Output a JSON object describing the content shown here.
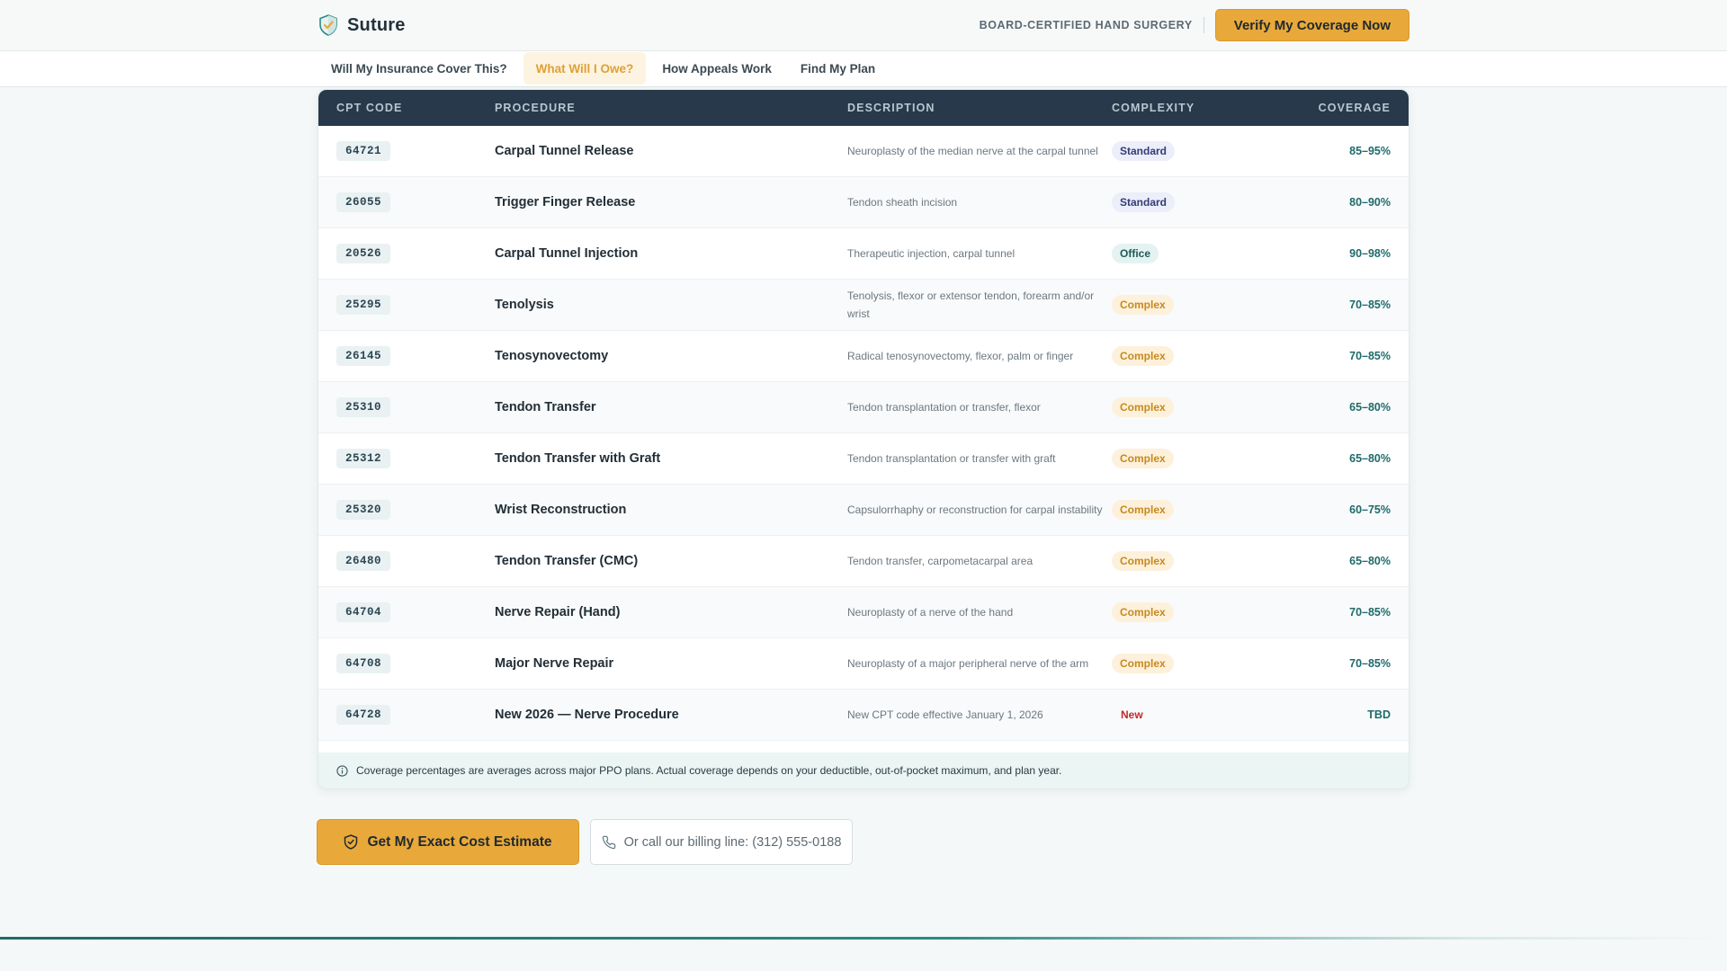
{
  "header": {
    "brand_name": "Suture",
    "tagline": "BOARD-CERTIFIED HAND SURGERY",
    "verify_label": "Verify My Coverage Now"
  },
  "nav": {
    "tabs": [
      {
        "label": "Will My Insurance Cover This?",
        "active": false
      },
      {
        "label": "What Will I Owe?",
        "active": true
      },
      {
        "label": "How Appeals Work",
        "active": false
      },
      {
        "label": "Find My Plan",
        "active": false
      }
    ]
  },
  "table": {
    "headers": {
      "code": "CPT CODE",
      "procedure": "PROCEDURE",
      "description": "DESCRIPTION",
      "complexity": "COMPLEXITY",
      "coverage": "COVERAGE"
    },
    "rows": [
      {
        "code": "64721",
        "procedure": "Carpal Tunnel Release",
        "description": "Neuroplasty of the median nerve at the carpal tunnel",
        "complexity": "Standard",
        "coverage": "85–95%"
      },
      {
        "code": "26055",
        "procedure": "Trigger Finger Release",
        "description": "Tendon sheath incision",
        "complexity": "Standard",
        "coverage": "80–90%"
      },
      {
        "code": "20526",
        "procedure": "Carpal Tunnel Injection",
        "description": "Therapeutic injection, carpal tunnel",
        "complexity": "Office",
        "coverage": "90–98%"
      },
      {
        "code": "25295",
        "procedure": "Tenolysis",
        "description": "Tenolysis, flexor or extensor tendon, forearm and/or wrist",
        "complexity": "Complex",
        "coverage": "70–85%"
      },
      {
        "code": "26145",
        "procedure": "Tenosynovectomy",
        "description": "Radical tenosynovectomy, flexor, palm or finger",
        "complexity": "Complex",
        "coverage": "70–85%"
      },
      {
        "code": "25310",
        "procedure": "Tendon Transfer",
        "description": "Tendon transplantation or transfer, flexor",
        "complexity": "Complex",
        "coverage": "65–80%"
      },
      {
        "code": "25312",
        "procedure": "Tendon Transfer with Graft",
        "description": "Tendon transplantation or transfer with graft",
        "complexity": "Complex",
        "coverage": "65–80%"
      },
      {
        "code": "25320",
        "procedure": "Wrist Reconstruction",
        "description": "Capsulorrhaphy or reconstruction for carpal instability",
        "complexity": "Complex",
        "coverage": "60–75%"
      },
      {
        "code": "26480",
        "procedure": "Tendon Transfer (CMC)",
        "description": "Tendon transfer, carpometacarpal area",
        "complexity": "Complex",
        "coverage": "65–80%"
      },
      {
        "code": "64704",
        "procedure": "Nerve Repair (Hand)",
        "description": "Neuroplasty of a nerve of the hand",
        "complexity": "Complex",
        "coverage": "70–85%"
      },
      {
        "code": "64708",
        "procedure": "Major Nerve Repair",
        "description": "Neuroplasty of a major peripheral nerve of the arm",
        "complexity": "Complex",
        "coverage": "70–85%"
      },
      {
        "code": "64728",
        "procedure": "New 2026 — Nerve Procedure",
        "description": "New CPT code effective January 1, 2026",
        "complexity": "New",
        "coverage": "TBD"
      }
    ],
    "note": "Coverage percentages are averages across major PPO plans. Actual coverage depends on your deductible, out-of-pocket maximum, and plan year."
  },
  "cta": {
    "primary_label": "Get My Exact Cost Estimate",
    "secondary_label": "Or call our billing line: (312) 555-0188"
  },
  "icons": {
    "brand": "shield-logo-icon",
    "info": "info-icon",
    "cta_primary": "shield-icon",
    "cta_secondary": "phone-icon"
  },
  "colors": {
    "accent": "#e8a93a",
    "header_dark": "#27394b",
    "teal": "#1f6a6a"
  }
}
